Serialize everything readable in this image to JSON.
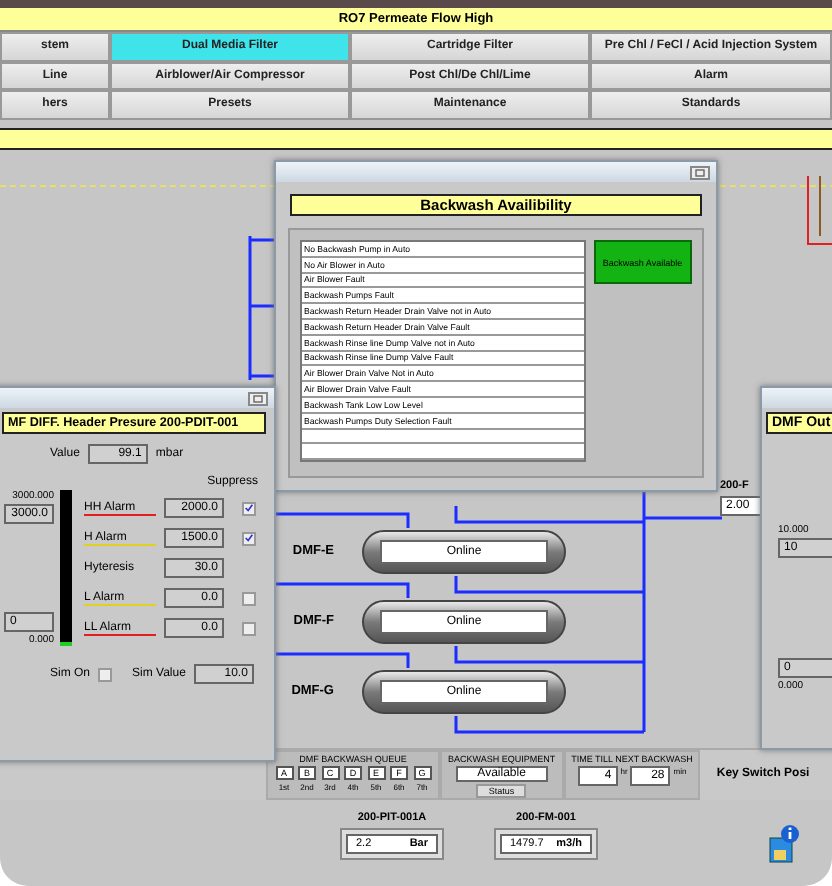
{
  "alarm_banner": "RO7 Permeate Flow High",
  "nav": [
    [
      {
        "label": "stem",
        "selected": false
      },
      {
        "label": "Dual Media Filter",
        "selected": true
      },
      {
        "label": "Cartridge Filter",
        "selected": false
      },
      {
        "label": "Pre Chl / FeCl / Acid Injection System",
        "selected": false
      }
    ],
    [
      {
        "label": "Line",
        "selected": false
      },
      {
        "label": "Airblower/Air Compressor",
        "selected": false
      },
      {
        "label": "Post Chl/De Chl/Lime",
        "selected": false
      },
      {
        "label": "Alarm",
        "selected": false
      }
    ],
    [
      {
        "label": "hers",
        "selected": false
      },
      {
        "label": "Presets",
        "selected": false
      },
      {
        "label": "Maintenance",
        "selected": false
      },
      {
        "label": "Standards",
        "selected": false
      }
    ]
  ],
  "filters": [
    {
      "name": "DMF-E",
      "status": "Online"
    },
    {
      "name": "DMF-F",
      "status": "Online"
    },
    {
      "name": "DMF-G",
      "status": "Online"
    }
  ],
  "flow_readout": {
    "label": "200-F",
    "value": "2.00"
  },
  "backwash_window": {
    "title": "Backwash Availibility",
    "conditions": [
      "No Backwash Pump in Auto",
      "No Air Blower in Auto",
      "Air Blower Fault",
      "Backwash Pumps Fault",
      "Backwash Return Header Drain Valve not in Auto",
      "Backwash Return Header Drain Valve Fault",
      "Backwash Rinse line Dump Valve not in Auto",
      "Backwash Rinse line Dump Valve Fault",
      "Air Blower Drain Valve Not in Auto",
      "Air Blower Drain Valve Fault",
      "Backwash Tank Low Low Level",
      "Backwash Pumps Duty Selection Fault"
    ],
    "indicator": "Backwash Available"
  },
  "pressure_window": {
    "title": "MF DIFF. Header  Presure 200-PDIT-001",
    "value_label": "Value",
    "value": "99.1",
    "unit": "mbar",
    "suppress_label": "Suppress",
    "scale_max": "3000.000",
    "scale_max_box": "3000.0",
    "scale_min_box": "0",
    "scale_min": "0.000",
    "level": 0.03,
    "rows": [
      {
        "kind": "alarm",
        "label": "HH Alarm",
        "value": "2000.0",
        "suppressed": true,
        "color": "#e02020"
      },
      {
        "kind": "alarm",
        "label": "H Alarm",
        "value": "1500.0",
        "suppressed": true,
        "color": "#e0d020"
      },
      {
        "kind": "setting",
        "label": "Hyteresis",
        "value": "30.0"
      },
      {
        "kind": "alarm",
        "label": "L Alarm",
        "value": "0.0",
        "suppressed": false,
        "color": "#e0d020"
      },
      {
        "kind": "alarm",
        "label": "LL Alarm",
        "value": "0.0",
        "suppressed": false,
        "color": "#e02020"
      }
    ],
    "sim_on_label": "Sim On",
    "sim_on": false,
    "sim_value_label": "Sim Value",
    "sim_value": "10.0"
  },
  "outlet_window": {
    "title": "DMF Out",
    "scale_max": "10.000",
    "scale_max_box": "10",
    "scale_min_box": "0",
    "scale_min": "0.000"
  },
  "queue": {
    "title": "DMF BACKWASH QUEUE",
    "filters": [
      "A",
      "B",
      "C",
      "D",
      "E",
      "F",
      "G"
    ],
    "orders": [
      "1st",
      "2nd",
      "3rd",
      "4th",
      "5th",
      "6th",
      "7th"
    ]
  },
  "equipment": {
    "title": "BACKWASH EQUIPMENT",
    "value": "Available",
    "button": "Status"
  },
  "timer": {
    "title": "TIME TILL NEXT BACKWASH",
    "hours": "4",
    "hours_unit": "hr",
    "minutes": "28",
    "minutes_unit": "min"
  },
  "key_switch": "Key Switch Posi",
  "gauges": [
    {
      "tag": "200-PIT-001A",
      "value": "2.2",
      "unit": "Bar"
    },
    {
      "tag": "200-FM-001",
      "value": "1479.7",
      "unit": "m3/h"
    }
  ]
}
